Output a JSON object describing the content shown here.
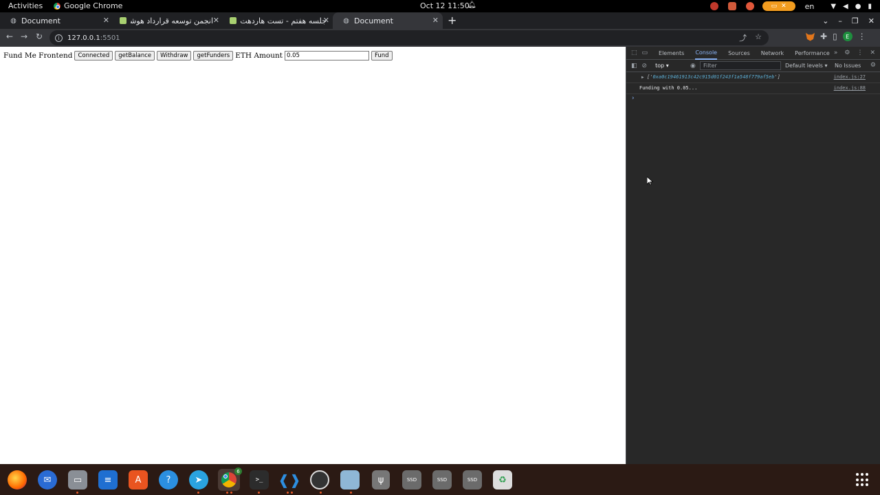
{
  "topbar": {
    "activities": "Activities",
    "app_name": "Google Chrome",
    "clock": "Oct 12  11:50",
    "lang": "en",
    "accent_pill": "#f29c1f"
  },
  "tabs": [
    {
      "title": "Document",
      "favicon": "globe-icon",
      "active": false
    },
    {
      "title": "انجمن توسعه قرارداد هوشـ",
      "favicon": "sheet-icon",
      "active": false
    },
    {
      "title": "جلسه هفتم - تست هاردهت",
      "favicon": "sheet-icon",
      "active": false
    },
    {
      "title": "Document",
      "favicon": "globe-icon",
      "active": true
    }
  ],
  "toolbar": {
    "url_host": "127.0.0.1",
    "url_port": ":5501"
  },
  "page": {
    "heading": "Fund Me Frontend",
    "connect_label": "Connected",
    "balance_label": "getBalance",
    "withdraw_label": "Withdraw",
    "funders_label": "getFunders",
    "amount_label": "ETH Amount",
    "amount_value": "0.05",
    "fund_label": "Fund"
  },
  "devtools": {
    "tabs": [
      "Elements",
      "Console",
      "Sources",
      "Network",
      "Performance"
    ],
    "active_tab": "Console",
    "context": "top",
    "filter_placeholder": "Filter",
    "levels": "Default levels",
    "issues": "No Issues",
    "logs": [
      {
        "message_prefix": "['",
        "message_value": "0xa0c19461913c42c915d01f243f1a548f779af5eb",
        "message_suffix": "']",
        "source": "index.js:27"
      },
      {
        "message": "Funding with 0.05...",
        "source": "index.js:88"
      }
    ]
  },
  "dock": {
    "chrome_badge": "6",
    "terminal_glyph": ">_",
    "drive_label": "SSD"
  }
}
